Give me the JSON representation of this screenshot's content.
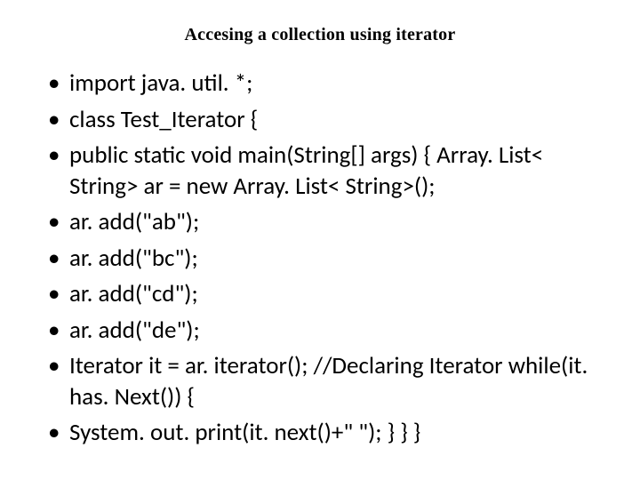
{
  "slide": {
    "title": "Accesing a collection using iterator",
    "bullets": [
      "import java. util. *;",
      "class Test_Iterator {",
      "public static void main(String[] args) { Array. List< String> ar = new Array. List< String>();",
      "ar. add(\"ab\");",
      "ar. add(\"bc\");",
      "ar. add(\"cd\");",
      "ar. add(\"de\");",
      "Iterator it = ar. iterator(); //Declaring Iterator while(it. has. Next()) {",
      " System. out. print(it. next()+\" \"); } } }"
    ]
  }
}
